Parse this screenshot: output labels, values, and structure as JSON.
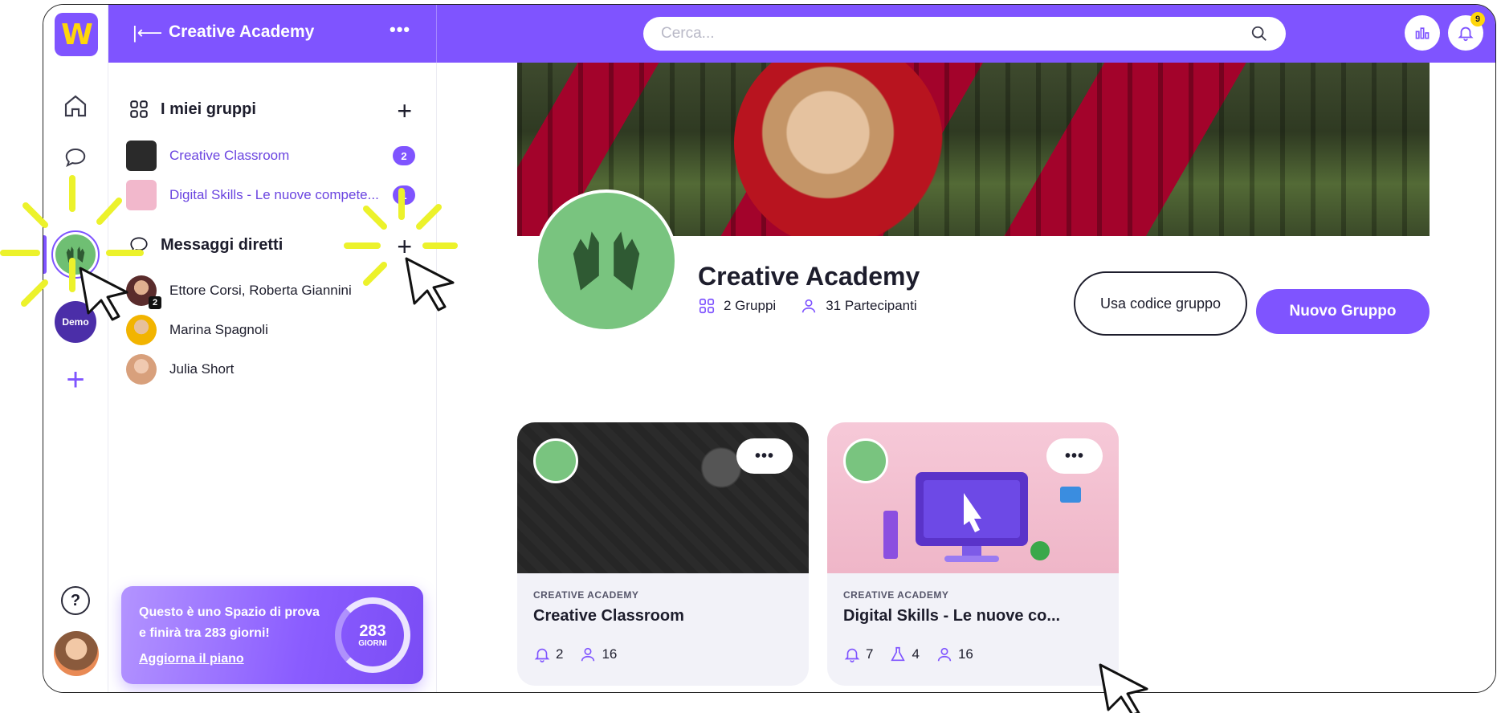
{
  "colors": {
    "accent": "#7f54ff",
    "highlight": "#ffd60a",
    "banner_red": "#a3032b"
  },
  "rail": {
    "logo_letter": "W",
    "demo_label": "Demo",
    "icons": [
      "home-icon",
      "chat-icon",
      "help-icon"
    ]
  },
  "topbar": {
    "space_title": "Creative Academy",
    "more_label": "•••",
    "search_placeholder": "Cerca...",
    "notifications_count": "9"
  },
  "sidebar": {
    "groups_header": "I miei gruppi",
    "groups": [
      {
        "label": "Creative Classroom",
        "count": "2"
      },
      {
        "label": "Digital Skills - Le nuove compete...",
        "count": "1"
      }
    ],
    "dm_header": "Messaggi diretti",
    "dms": [
      {
        "label": "Ettore Corsi, Roberta Giannini",
        "badge": "2"
      },
      {
        "label": "Marina Spagnoli"
      },
      {
        "label": "Julia Short"
      }
    ],
    "promo": {
      "text": "Questo è uno Spazio di prova e finirà tra 283 giorni!",
      "link": "Aggiorna il piano",
      "days": "283",
      "days_label": "GIORNI"
    }
  },
  "main": {
    "space_title": "Creative Academy",
    "groups_count": "2 Gruppi",
    "participants_count": "31 Partecipanti",
    "btn_code": "Usa codice gruppo",
    "btn_new": "Nuovo Gruppo",
    "cards": [
      {
        "kicker": "CREATIVE ACADEMY",
        "title": "Creative Classroom",
        "notifications": "2",
        "members": "16"
      },
      {
        "kicker": "CREATIVE ACADEMY",
        "title": "Digital Skills - Le nuove co...",
        "notifications": "7",
        "tests": "4",
        "members": "16"
      }
    ],
    "more_label": "•••"
  }
}
